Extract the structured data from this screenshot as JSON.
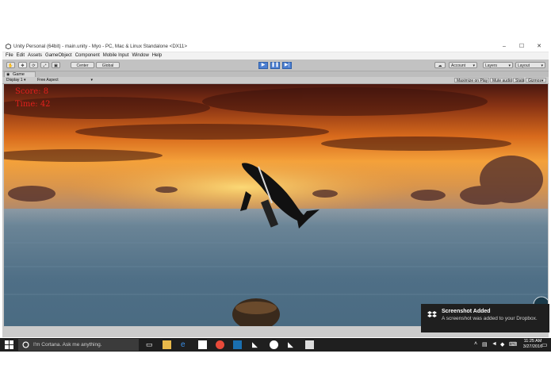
{
  "window": {
    "title": "Unity Personal (64bit) - main.unity - Myo - PC, Mac & Linux Standalone <DX11>",
    "minimize": "–",
    "maximize": "☐",
    "close": "✕"
  },
  "menu": [
    "File",
    "Edit",
    "Assets",
    "GameObject",
    "Component",
    "Mobile Input",
    "Window",
    "Help"
  ],
  "toolbar": {
    "pivot": "Center",
    "space": "Global",
    "account": "Account",
    "layers": "Layers",
    "layout": "Layout"
  },
  "tab": {
    "label": "Game"
  },
  "game_bar": {
    "display": "Display 1",
    "aspect": "Free Aspect",
    "maximize_on_play": "Maximize on Play",
    "mute_audio": "Mute audio",
    "stats": "Stats",
    "gizmos": "Gizmos"
  },
  "hud": {
    "line1": "Score: 8",
    "line2": "Time: 42"
  },
  "taskbar": {
    "cortana_placeholder": "I'm Cortana. Ask me anything.",
    "time": "11:25 AM",
    "date": "3/27/2016"
  },
  "notification": {
    "title": "Screenshot Added",
    "body": "A screenshot was added to your Dropbox."
  },
  "colors": {
    "sky_top": "#5a1e12",
    "sunset": "#f29a32",
    "sea": "#4f6f86",
    "taskbar": "#1f1f1f",
    "play_accent": "#4c7fd1"
  }
}
